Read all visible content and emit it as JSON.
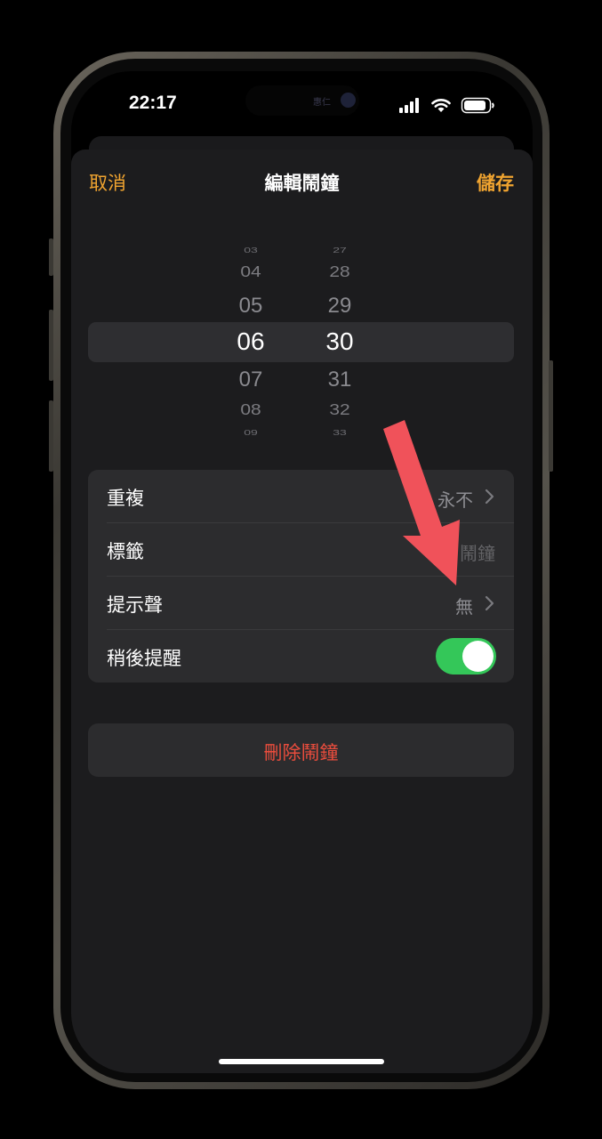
{
  "status_bar": {
    "time": "22:17",
    "island_label": "惠仁"
  },
  "nav": {
    "cancel": "取消",
    "title": "編輯鬧鐘",
    "save": "儲存"
  },
  "picker": {
    "hours": [
      "03",
      "04",
      "05",
      "06",
      "07",
      "08",
      "09"
    ],
    "minutes": [
      "27",
      "28",
      "29",
      "30",
      "31",
      "32",
      "33"
    ],
    "selected_hour": "06",
    "selected_minute": "30"
  },
  "settings": {
    "repeat_label": "重複",
    "repeat_value": "永不",
    "label_label": "標籤",
    "label_value": "鬧鐘",
    "sound_label": "提示聲",
    "sound_value": "無",
    "snooze_label": "稍後提醒",
    "snooze_on": true
  },
  "delete": {
    "label": "刪除鬧鐘"
  },
  "colors": {
    "accent": "#f0a430",
    "toggle_on": "#34c759",
    "destructive": "#eb4d3d",
    "annotation_arrow": "#f0525a"
  }
}
